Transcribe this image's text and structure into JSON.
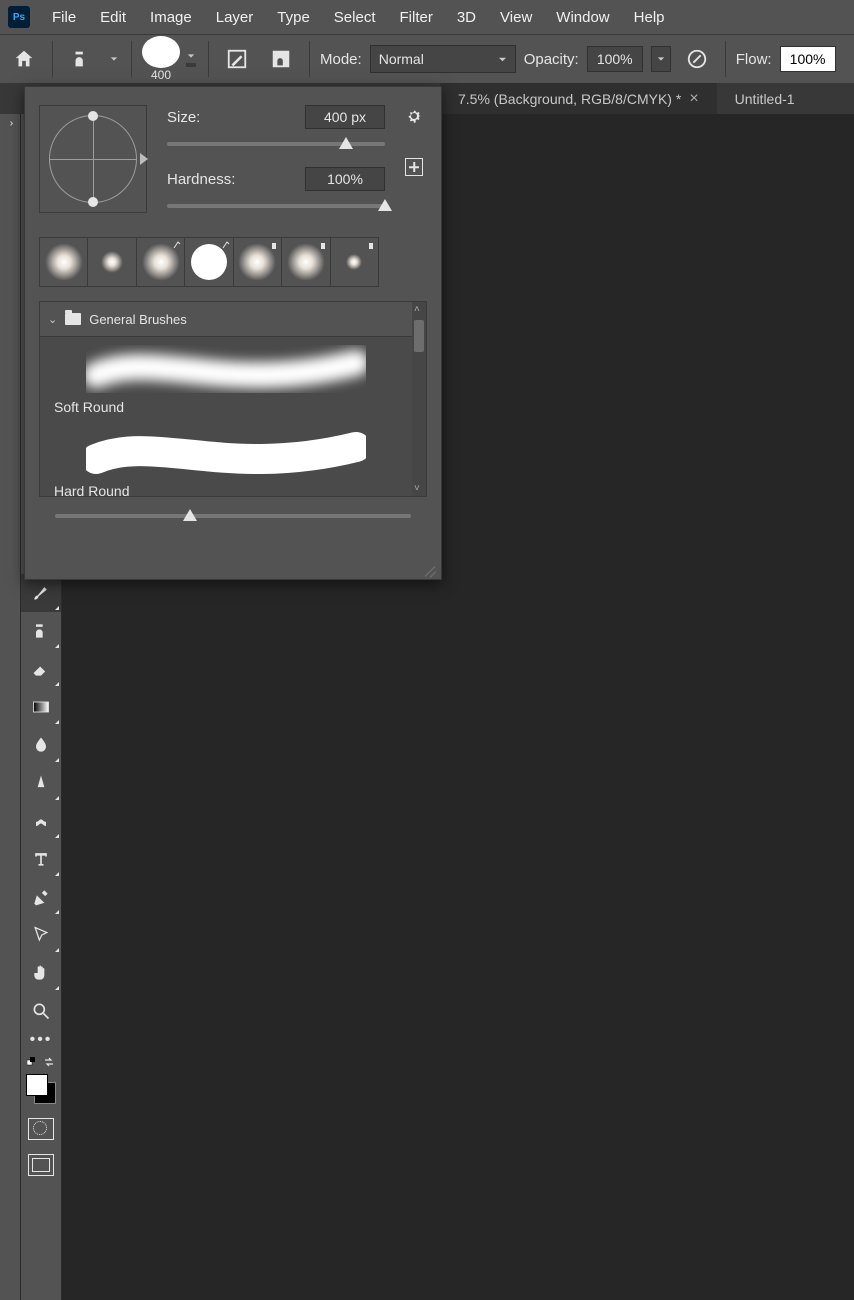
{
  "menu": {
    "items": [
      "File",
      "Edit",
      "Image",
      "Layer",
      "Type",
      "Select",
      "Filter",
      "3D",
      "View",
      "Window",
      "Help"
    ]
  },
  "optbar": {
    "brush_size": "400",
    "mode_label": "Mode:",
    "mode_value": "Normal",
    "opacity_label": "Opacity:",
    "opacity_value": "100%",
    "flow_label": "Flow:",
    "flow_value": "100%"
  },
  "tabs": {
    "t0": "7.5% (Background, RGB/8/CMYK) *",
    "t1": "Untitled-1"
  },
  "brush_panel": {
    "size_label": "Size:",
    "size_value": "400 px",
    "hardness_label": "Hardness:",
    "hardness_value": "100%",
    "folder": "General Brushes",
    "b0": "Soft Round",
    "b1": "Hard Round"
  }
}
